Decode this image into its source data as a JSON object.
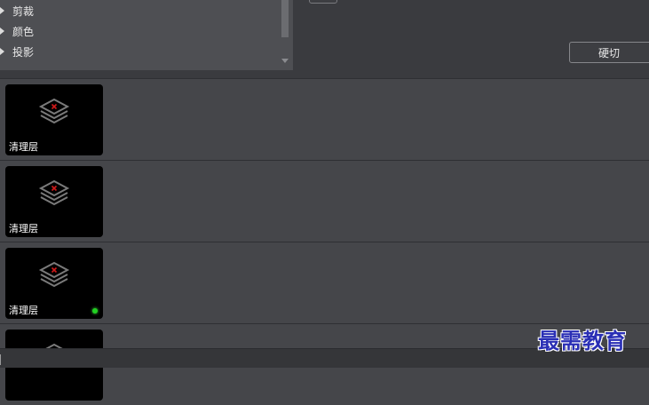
{
  "effects_tree": {
    "items": [
      {
        "label": "剪裁"
      },
      {
        "label": "颜色"
      },
      {
        "label": "投影"
      }
    ],
    "cutoff_label": "…"
  },
  "transition": {
    "hard_cut_label": "硬切"
  },
  "layers": [
    {
      "label": "清理层",
      "active": false
    },
    {
      "label": "清理层",
      "active": false
    },
    {
      "label": "清理层",
      "active": true
    }
  ],
  "watermark": "最需教育",
  "colors": {
    "active_indicator": "#22d122",
    "watermark": "#2a2fb5",
    "clear_icon_x": "#d11a1a"
  }
}
